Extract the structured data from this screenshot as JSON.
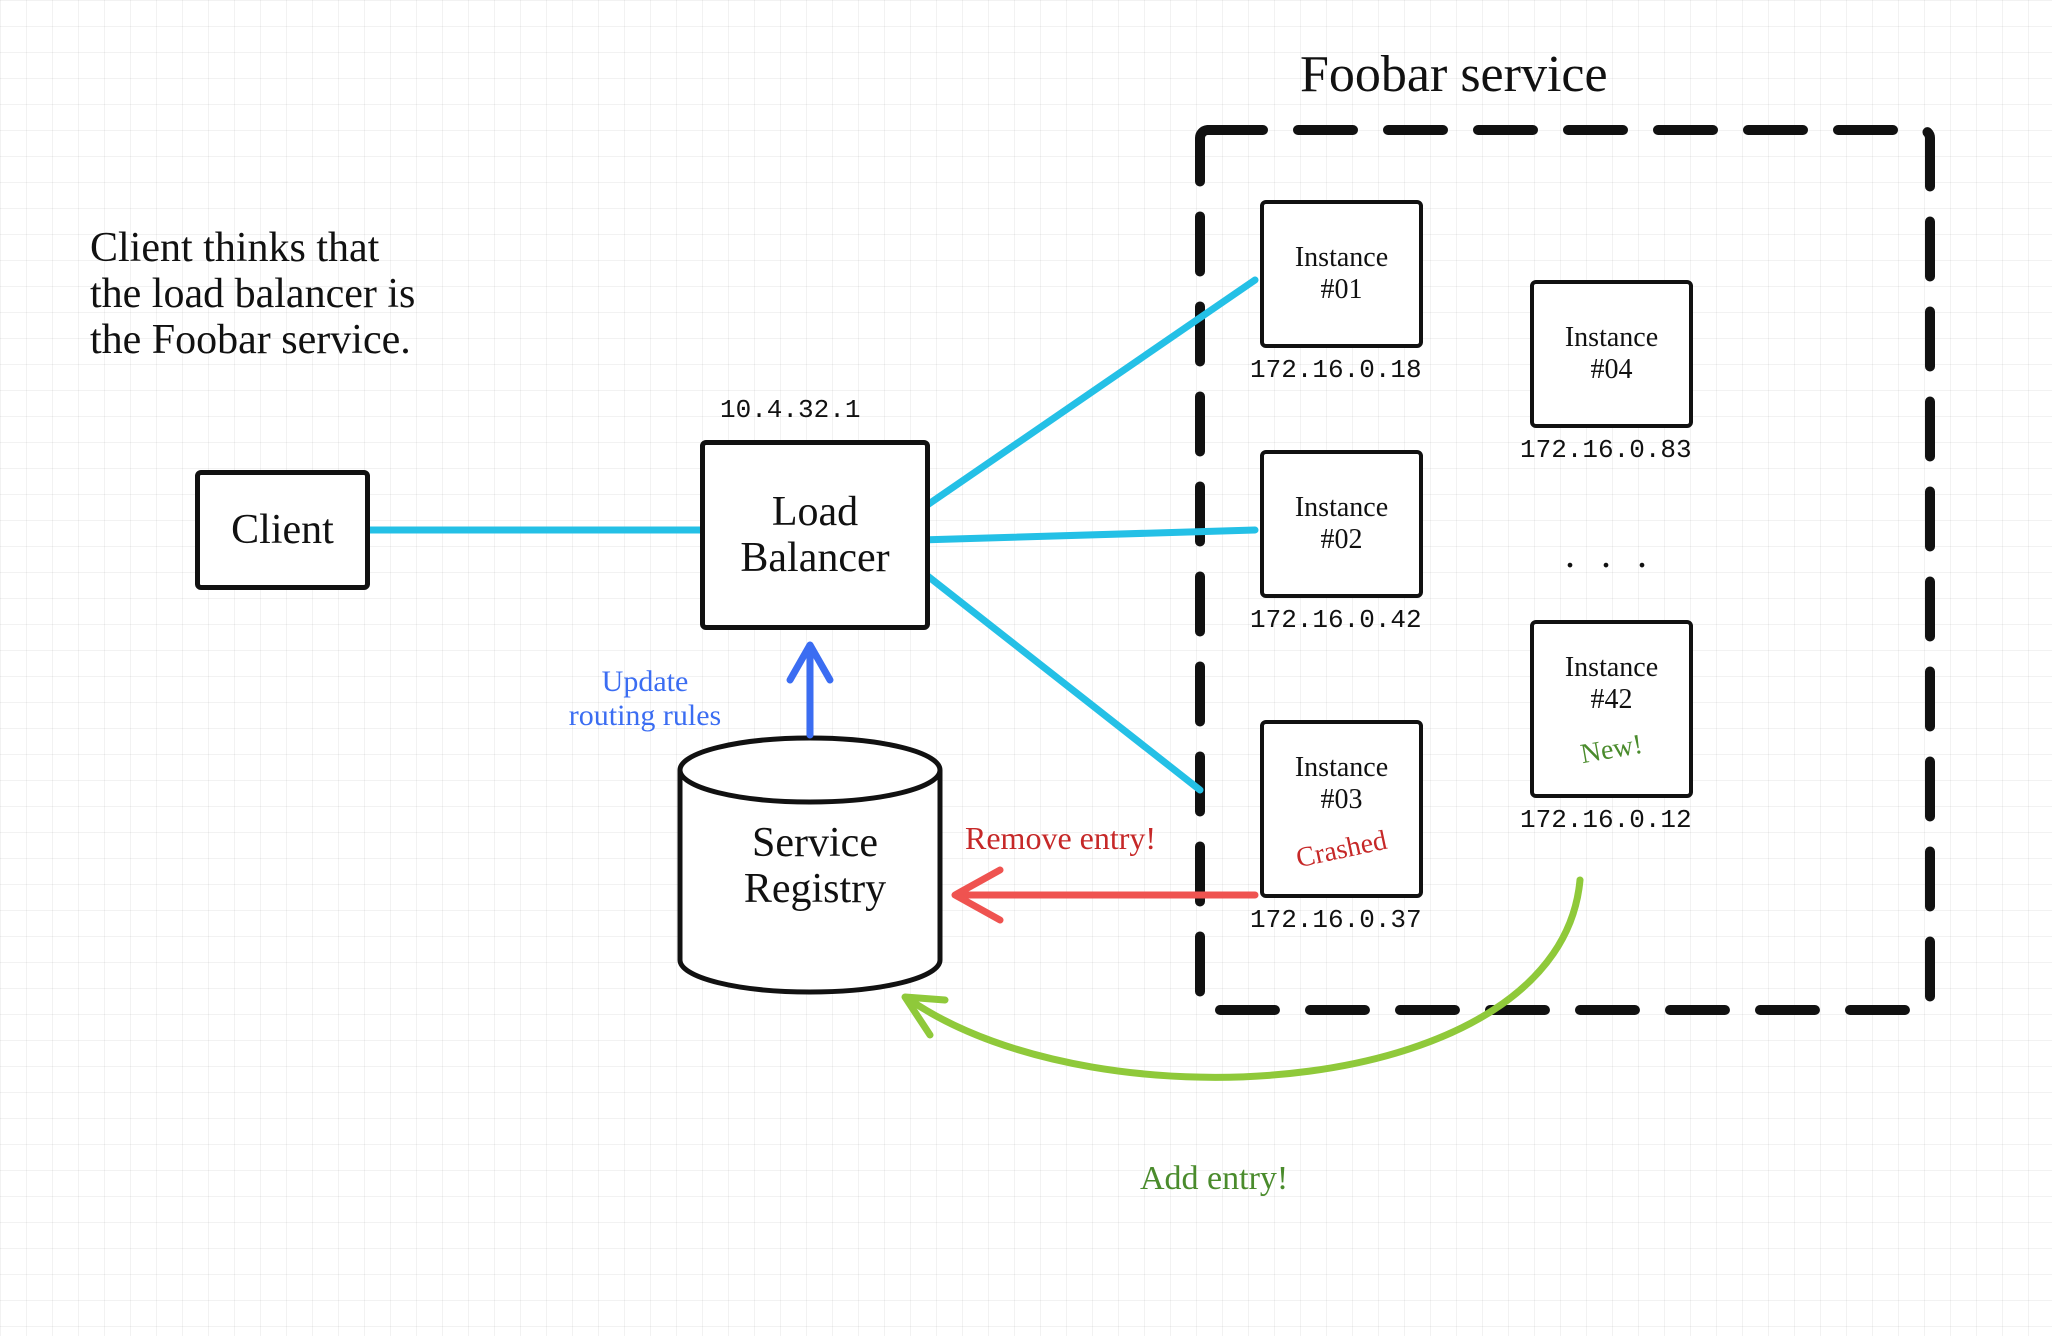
{
  "caption": "Client thinks that\nthe load balancer is\nthe Foobar service.",
  "client": {
    "label": "Client"
  },
  "lb": {
    "label": "Load\nBalancer",
    "ip": "10.4.32.1"
  },
  "registry": {
    "label": "Service\nRegistry"
  },
  "service_group": {
    "title": "Foobar service",
    "ellipsis": ". . ."
  },
  "instances": {
    "i1": {
      "name": "Instance\n#01",
      "ip": "172.16.0.18"
    },
    "i2": {
      "name": "Instance\n#02",
      "ip": "172.16.0.42"
    },
    "i3": {
      "name": "Instance\n#03",
      "ip": "172.16.0.37",
      "status": "Crashed"
    },
    "i4": {
      "name": "Instance\n#04",
      "ip": "172.16.0.83"
    },
    "i42": {
      "name": "Instance\n#42",
      "ip": "172.16.0.12",
      "status": "New!"
    }
  },
  "annotations": {
    "update": "Update\nrouting rules",
    "remove": "Remove entry!",
    "add": "Add entry!"
  },
  "colors": {
    "cyan": "#24c0e6",
    "blue": "#3b6df2",
    "red": "#ef5350",
    "green": "#8fc93a",
    "darkgreen": "#4a8b2c",
    "darkred": "#c62828"
  }
}
